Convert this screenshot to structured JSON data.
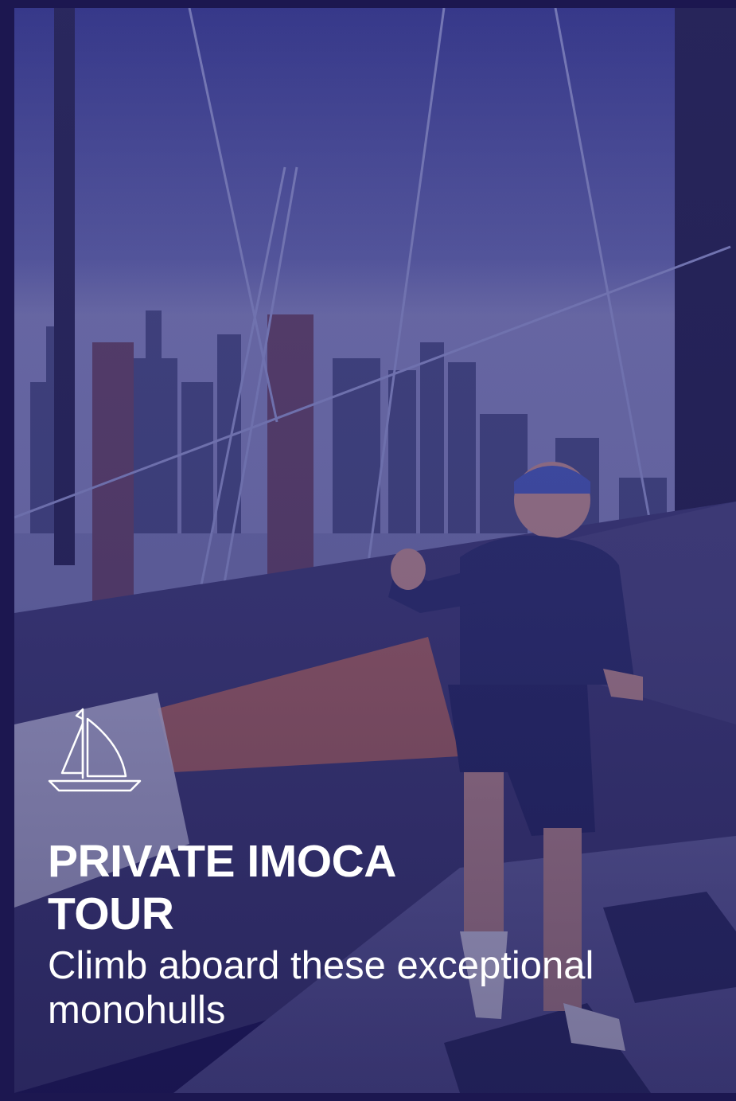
{
  "card": {
    "title_line1": "PRIVATE IMOCA",
    "title_line2": "TOUR",
    "subtitle": "Climb aboard these exceptional monohulls",
    "icon": "sailboat-icon",
    "photo": "sailor giving thumbs up on IMOCA deck with city skyline"
  },
  "colors": {
    "frame": "#1c1750",
    "overlay": "#2e2a82",
    "text": "#ffffff"
  }
}
